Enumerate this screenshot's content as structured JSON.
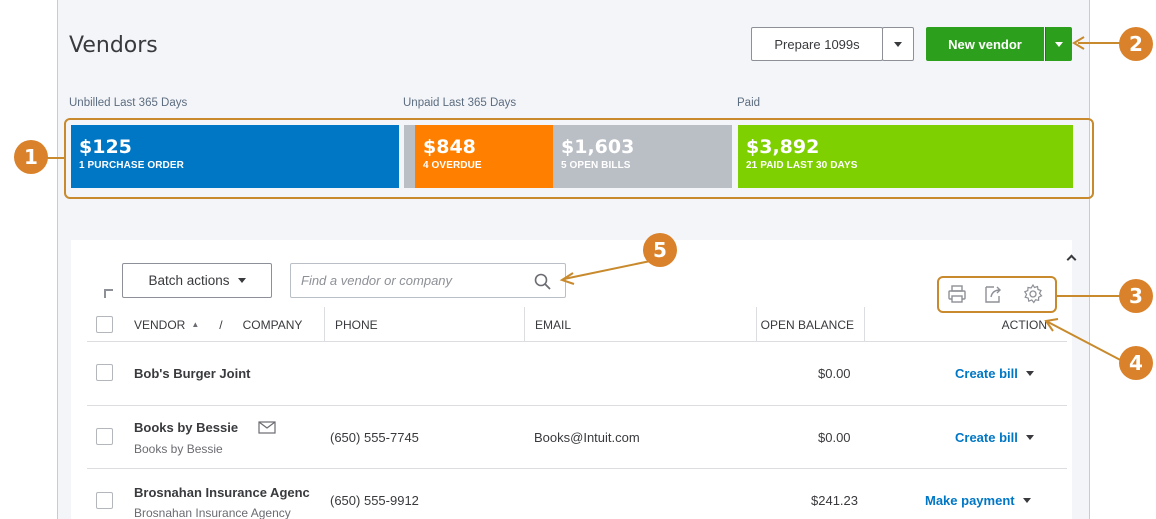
{
  "page": {
    "title": "Vendors"
  },
  "toolbar": {
    "prepare_label": "Prepare 1099s",
    "new_vendor_label": "New vendor"
  },
  "money_bar": {
    "sections": [
      {
        "label": "Unbilled Last 365 Days"
      },
      {
        "label": "Unpaid Last 365 Days"
      },
      {
        "label": "Paid"
      }
    ],
    "tiles": [
      {
        "amount": "$125",
        "caption": "1 PURCHASE ORDER",
        "color": "#0077c5"
      },
      {
        "amount": "$848",
        "caption": "4 OVERDUE",
        "color": "#ff8000"
      },
      {
        "amount": "$1,603",
        "caption": "5 OPEN BILLS",
        "color": "#babec5"
      },
      {
        "amount": "$3,892",
        "caption": "21 PAID LAST 30 DAYS",
        "color": "#7fd000"
      }
    ]
  },
  "list": {
    "batch_label": "Batch actions",
    "search_placeholder": "Find a vendor or company",
    "icons": [
      "print-icon",
      "export-icon",
      "settings-gear-icon"
    ],
    "columns": {
      "vendor": "VENDOR",
      "sort_indicator": "▲",
      "sep": "/",
      "company": "COMPANY",
      "phone": "PHONE",
      "email": "EMAIL",
      "open_balance": "OPEN BALANCE",
      "action": "ACTION"
    },
    "rows": [
      {
        "vendor": "Bob's Burger Joint",
        "company": "",
        "phone": "",
        "email": "",
        "balance": "$0.00",
        "action": "Create bill"
      },
      {
        "vendor": "Books by Bessie",
        "company": "Books by Bessie",
        "phone": "(650) 555-7745",
        "email": "Books@Intuit.com",
        "balance": "$0.00",
        "action": "Create bill"
      },
      {
        "vendor": "Brosnahan Insurance Agenc",
        "company": "Brosnahan Insurance Agency",
        "phone": "(650) 555-9912",
        "email": "",
        "balance": "$241.23",
        "action": "Make payment"
      }
    ]
  },
  "callouts": [
    "1",
    "2",
    "3",
    "4",
    "5"
  ],
  "colors": {
    "callout": "#d9822b",
    "accent_green": "#2ca01c",
    "link_blue": "#0077c5"
  }
}
